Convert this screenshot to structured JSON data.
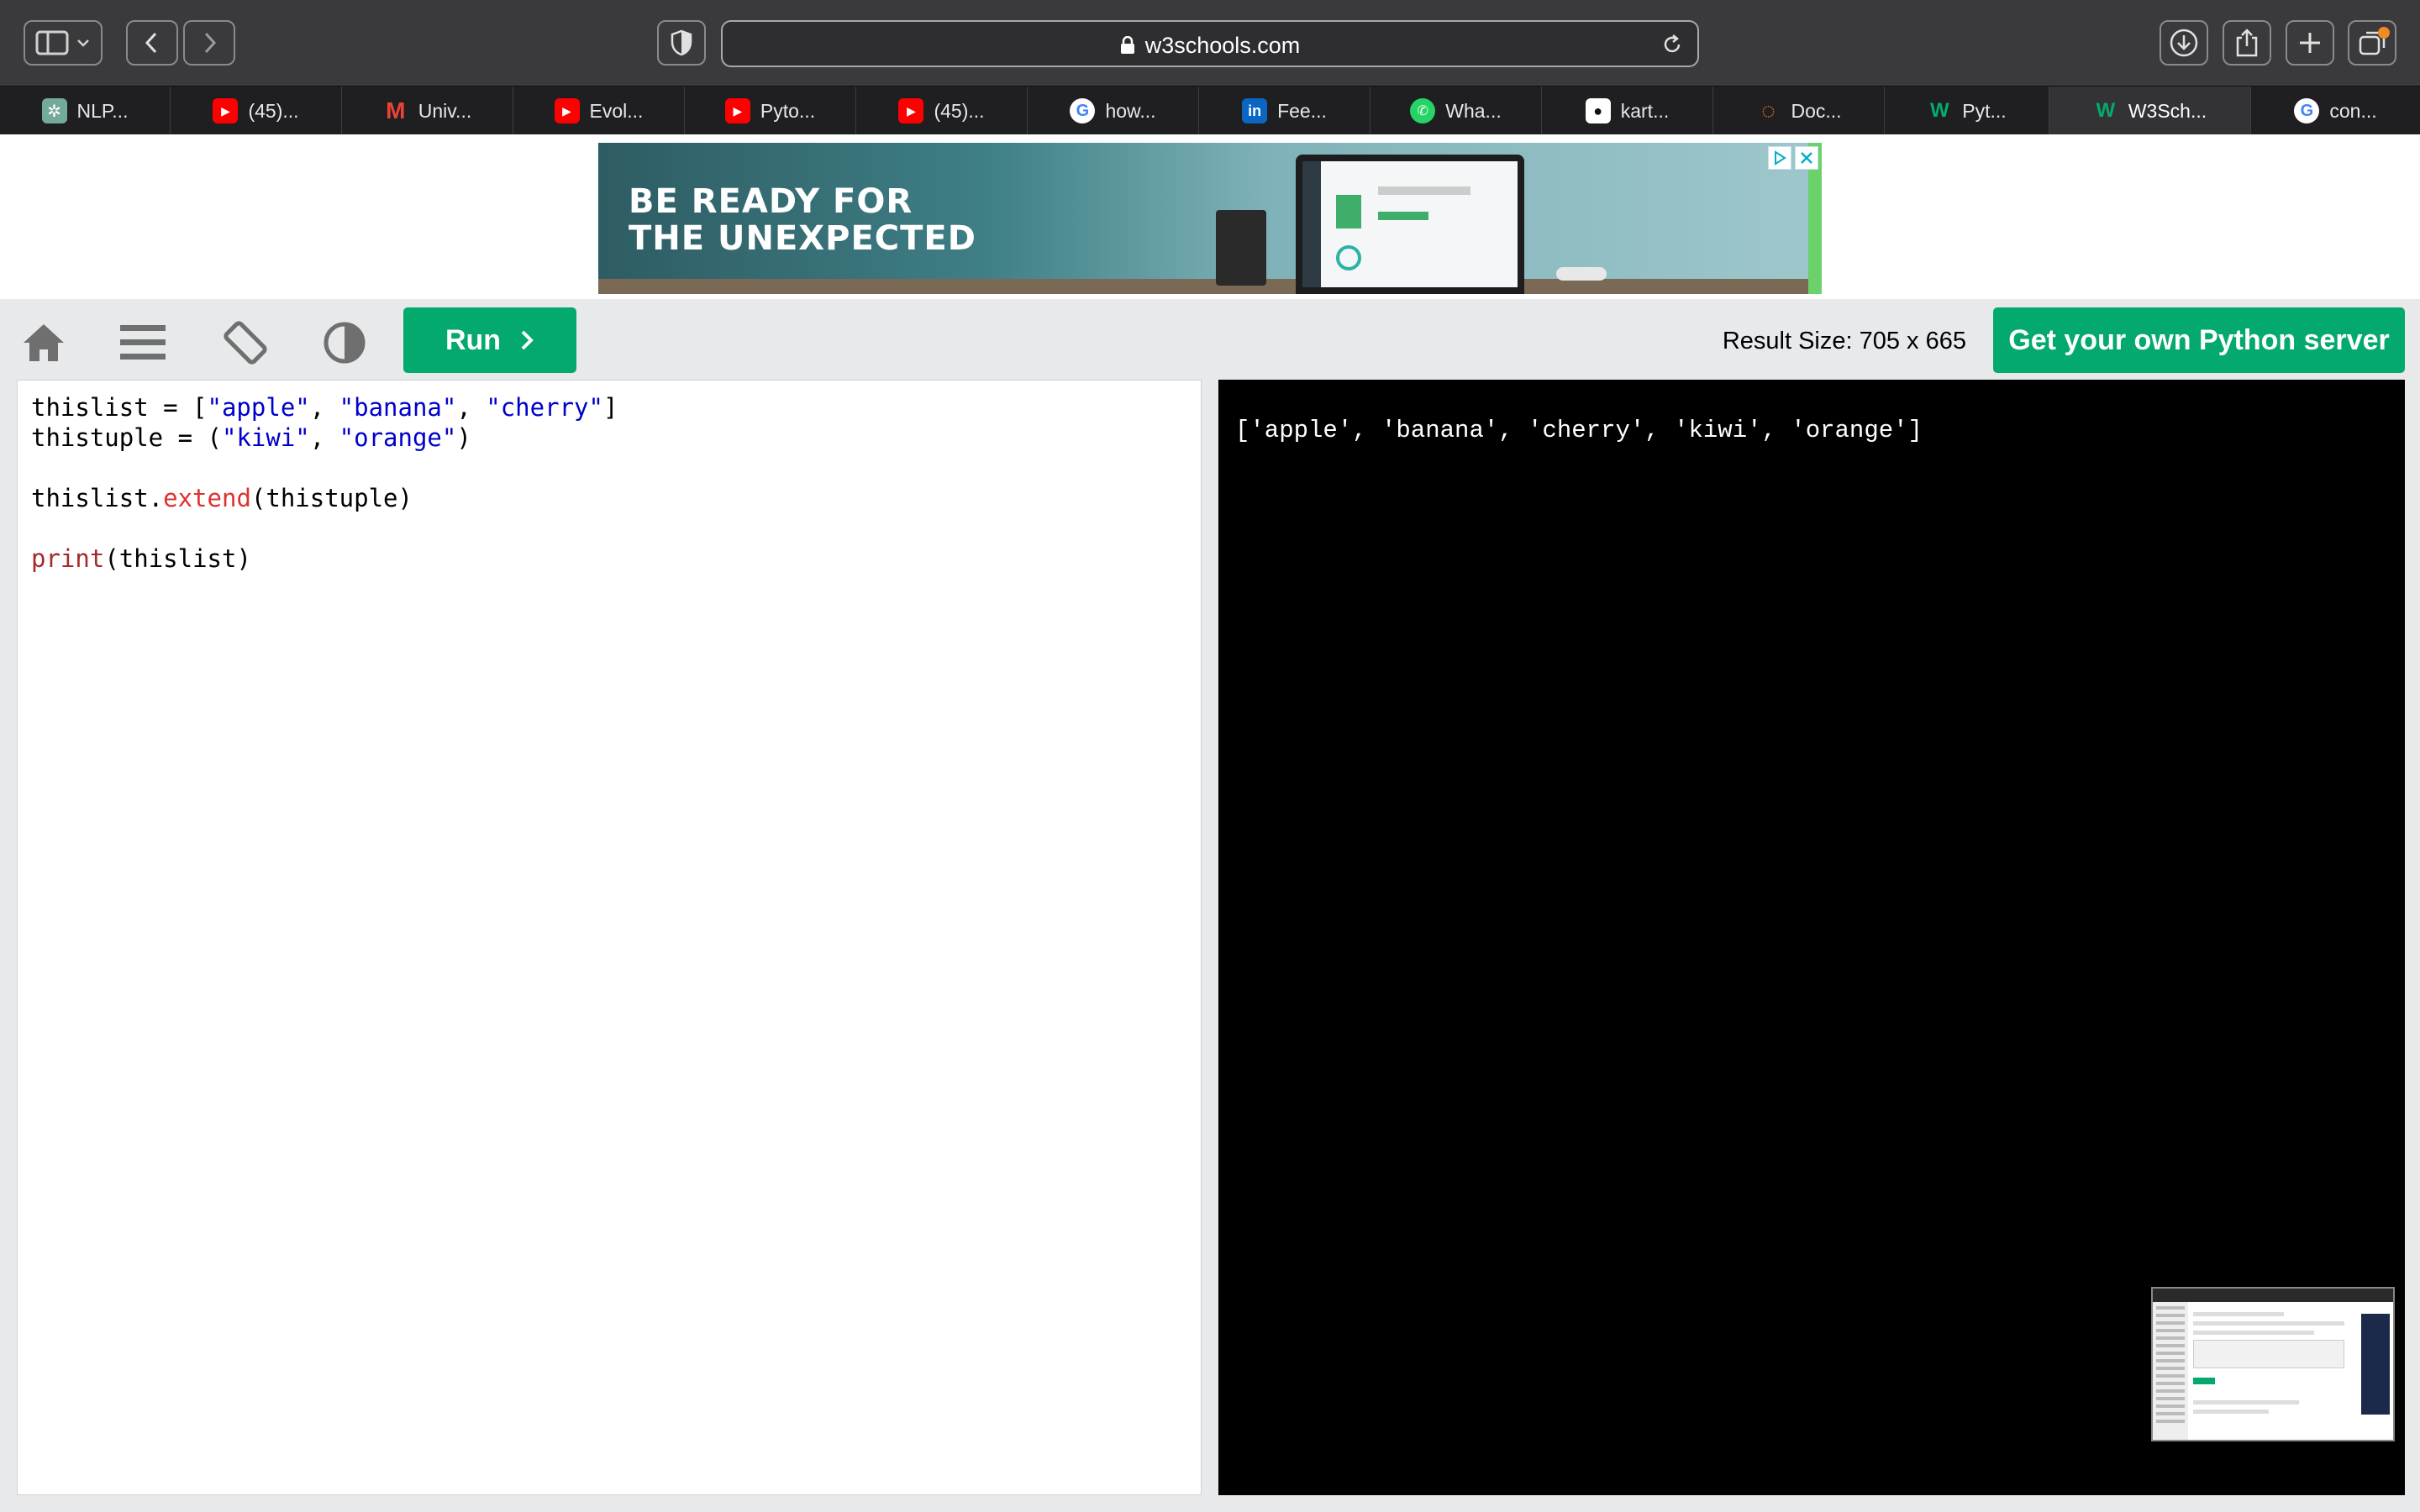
{
  "browser": {
    "url": "w3schools.com",
    "tabs": [
      {
        "label": "NLP...",
        "icon": "openai-icon",
        "active": false
      },
      {
        "label": "(45)...",
        "icon": "youtube-icon",
        "active": false
      },
      {
        "label": "Univ...",
        "icon": "gmail-icon",
        "active": false
      },
      {
        "label": "Evol...",
        "icon": "youtube-icon",
        "active": false
      },
      {
        "label": "Pyto...",
        "icon": "youtube-icon",
        "active": false
      },
      {
        "label": "(45)...",
        "icon": "youtube-icon",
        "active": false
      },
      {
        "label": "how...",
        "icon": "google-icon",
        "active": false
      },
      {
        "label": "Fee...",
        "icon": "linkedin-icon",
        "active": false
      },
      {
        "label": "Wha...",
        "icon": "whatsapp-icon",
        "active": false
      },
      {
        "label": "kart...",
        "icon": "github-icon",
        "active": false
      },
      {
        "label": "Doc...",
        "icon": "jupyter-icon",
        "active": false
      },
      {
        "label": "Pyt...",
        "icon": "w3schools-icon",
        "active": false
      },
      {
        "label": "W3Sch...",
        "icon": "w3schools-icon",
        "active": true
      },
      {
        "label": "con...",
        "icon": "google-icon",
        "active": false
      }
    ]
  },
  "ad": {
    "headline": "BE READY FOR\nTHE UNEXPECTED"
  },
  "controls": {
    "run_label": "Run",
    "result_size": "Result Size: 705 x 665",
    "own_server_label": "Get your own Python server"
  },
  "editor": {
    "code_lines": [
      "thislist = [\"apple\", \"banana\", \"cherry\"]",
      "thistuple = (\"kiwi\", \"orange\")",
      "",
      "thislist.extend(thistuple)",
      "",
      "print(thislist)"
    ]
  },
  "result": {
    "output": "['apple', 'banana', 'cherry', 'kiwi', 'orange']"
  },
  "colors": {
    "w3_green": "#04aa6d",
    "string": "#0000cd",
    "method": "#dc322f",
    "keyword": "#a52a2a"
  }
}
